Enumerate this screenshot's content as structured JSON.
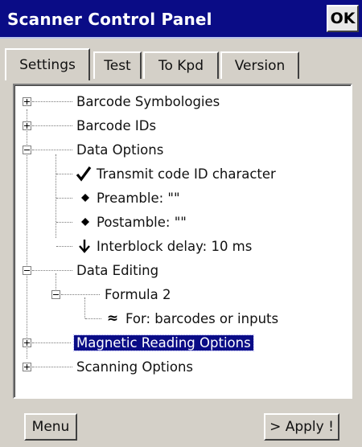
{
  "window": {
    "title": "Scanner Control Panel",
    "ok_label": "OK"
  },
  "tabs": [
    {
      "label": "Settings",
      "active": true
    },
    {
      "label": "Test",
      "active": false
    },
    {
      "label": "To Kpd",
      "active": false
    },
    {
      "label": "Version",
      "active": false
    }
  ],
  "tree": {
    "items": [
      {
        "label": "Barcode Symbologies",
        "expander": "plus"
      },
      {
        "label": "Barcode IDs",
        "expander": "plus"
      },
      {
        "label": "Data Options",
        "expander": "minus"
      },
      {
        "label": "Transmit code ID character",
        "icon": "checkmark-icon"
      },
      {
        "label": "Preamble: \"\"",
        "icon": "diamond-bullet-icon"
      },
      {
        "label": "Postamble: \"\"",
        "icon": "diamond-bullet-icon"
      },
      {
        "label": "Interblock delay: 10 ms",
        "icon": "down-arrow-icon"
      },
      {
        "label": "Data Editing",
        "expander": "minus"
      },
      {
        "label": "Formula 2",
        "expander": "minus"
      },
      {
        "label": "For: barcodes or inputs",
        "icon": "approx-icon"
      },
      {
        "label": "Magnetic Reading Options",
        "expander": "plus",
        "selected": true
      },
      {
        "label": "Scanning Options",
        "expander": "plus"
      }
    ]
  },
  "bottom": {
    "menu_label": "Menu",
    "apply_label": "> Apply !"
  },
  "colors": {
    "titlebar": "#0a0c86",
    "selection": "#0a0c86",
    "chrome": "#d4d0c8"
  }
}
